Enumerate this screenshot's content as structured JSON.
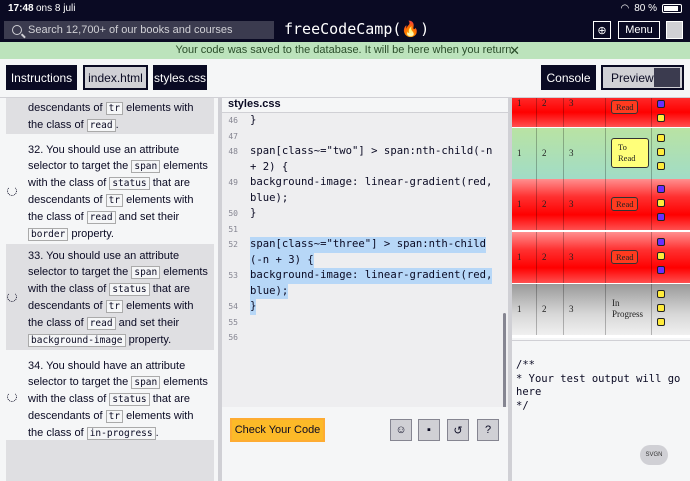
{
  "status_bar": {
    "time": "17:48",
    "date": "ons 8 juli",
    "battery": "80 %"
  },
  "nav": {
    "search_placeholder": "Search 12,700+ of our books and courses",
    "logo": "freeCodeCamp(🔥)",
    "menu_label": "Menu"
  },
  "flash": {
    "message": "Your code was saved to the database. It will be here when you return.",
    "close": "✕"
  },
  "tabs": {
    "instructions": "Instructions",
    "index": "index.html",
    "styles": "styles.css",
    "console": "Console",
    "preview": "Preview"
  },
  "hints": {
    "h31": {
      "t1": "descendants of ",
      "c1": "tr",
      "t2": " elements with the class of ",
      "c2": "read",
      "t3": "."
    },
    "h32": {
      "t1": "32. You should use an attribute selector to target the ",
      "c1": "span",
      "t2": " elements with the class of ",
      "c2": "status",
      "t3": " that are descendants of ",
      "c3": "tr",
      "t4": " elements with the class of ",
      "c4": "read",
      "t5": " and set their ",
      "c5": "border",
      "t6": " property."
    },
    "h33": {
      "t1": "33. You should use an attribute selector to target the ",
      "c1": "span",
      "t2": " elements with the class of ",
      "c2": "status",
      "t3": " that are descendants of ",
      "c3": "tr",
      "t4": " elements with the class of ",
      "c4": "read",
      "t5": " and set their ",
      "c5": "background-image",
      "t6": " property."
    },
    "h34": {
      "t1": "34. You should have an attribute selector to target the ",
      "c1": "span",
      "t2": " elements with the class of ",
      "c2": "status",
      "t3": " that are descendants of ",
      "c3": "tr",
      "t4": " elements with the class of ",
      "c4": "in-progress",
      "t5": "."
    }
  },
  "editor": {
    "file": "styles.css",
    "lines": [
      {
        "n": "46",
        "text": "}"
      },
      {
        "n": "47",
        "text": ""
      },
      {
        "n": "48",
        "text": "span[class~=\"two\"] > span:nth-child(-n"
      },
      {
        "n": "",
        "text": "+ 2) {"
      },
      {
        "n": "49",
        "text": "background-image: linear-gradient(red,"
      },
      {
        "n": "",
        "text": "blue);"
      },
      {
        "n": "50",
        "text": "}"
      },
      {
        "n": "51",
        "text": ""
      },
      {
        "n": "52",
        "text": "span[class~=\"three\"] > span:nth-child"
      },
      {
        "n": "",
        "text": "(-n + 3) {"
      },
      {
        "n": "53",
        "text": "background-image: linear-gradient(red,"
      },
      {
        "n": "",
        "text": "blue);"
      },
      {
        "n": "54",
        "text": "}"
      },
      {
        "n": "55",
        "text": ""
      },
      {
        "n": "56",
        "text": ""
      }
    ]
  },
  "toolbar": {
    "check": "Check Your Code"
  },
  "preview": {
    "rows": [
      {
        "c1": "1",
        "c2": "2",
        "c3": "3",
        "status": "Read",
        "style": "red"
      },
      {
        "c1": "1",
        "c2": "2",
        "c3": "3",
        "status": "To Read",
        "style": "yellow"
      },
      {
        "c1": "1",
        "c2": "2",
        "c3": "3",
        "status": "Read",
        "style": "red"
      },
      {
        "c1": "1",
        "c2": "2",
        "c3": "3",
        "status": "Read",
        "style": "red"
      },
      {
        "c1": "1",
        "c2": "2",
        "c3": "3",
        "status": "In Progress",
        "style": "text"
      }
    ]
  },
  "console": {
    "output": "/**\n* Your test output will go\nhere\n*/"
  },
  "svg_button": "SVGN"
}
